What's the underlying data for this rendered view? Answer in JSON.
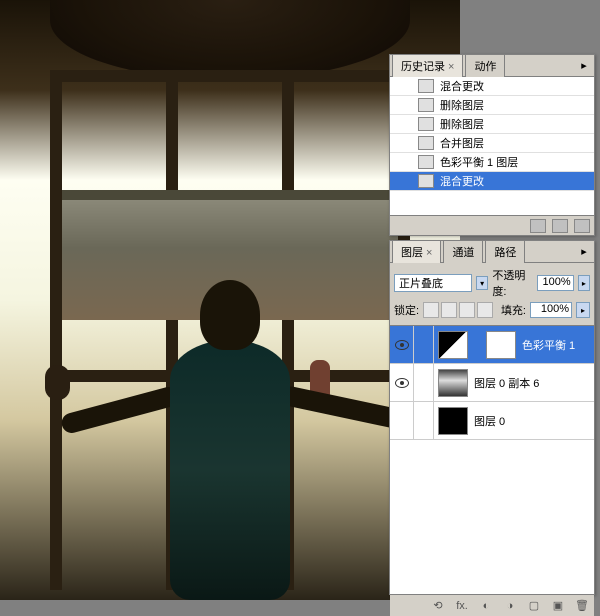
{
  "history": {
    "tab_history": "历史记录",
    "tab_actions": "动作",
    "items": [
      {
        "label": "混合更改"
      },
      {
        "label": "删除图层"
      },
      {
        "label": "删除图层"
      },
      {
        "label": "合并图层"
      },
      {
        "label": "色彩平衡 1 图层"
      },
      {
        "label": "混合更改"
      }
    ]
  },
  "layers": {
    "tab_layers": "图层",
    "tab_channels": "通道",
    "tab_paths": "路径",
    "blend_mode": "正片叠底",
    "opacity_label": "不透明度:",
    "opacity_value": "100%",
    "lock_label": "锁定:",
    "fill_label": "填充:",
    "fill_value": "100%",
    "items": [
      {
        "name": "色彩平衡 1",
        "type": "adjustment"
      },
      {
        "name": "图层 0 副本 6",
        "type": "image"
      },
      {
        "name": "图层 0",
        "type": "dark"
      }
    ]
  }
}
